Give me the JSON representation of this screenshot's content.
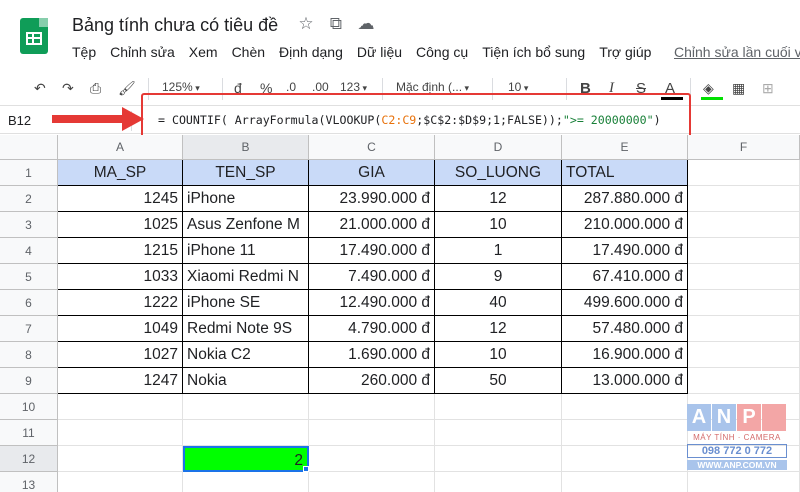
{
  "header": {
    "title": "Bảng tính chưa có tiêu đề",
    "star_icon": "star-icon",
    "move_icon": "folder-move-icon",
    "cloud_icon": "cloud-status-icon"
  },
  "menu": {
    "items": [
      "Tệp",
      "Chỉnh sửa",
      "Xem",
      "Chèn",
      "Định dạng",
      "Dữ liệu",
      "Công cụ",
      "Tiện ích bổ sung",
      "Trợ giúp"
    ],
    "last_edit": "Chỉnh sửa lần cuối v"
  },
  "toolbar": {
    "zoom": "125%",
    "currency": "đ",
    "percent": "%",
    "dec_less": ".0",
    "dec_more": ".00",
    "number_format": "123",
    "font": "Mặc định (...",
    "font_size": "10",
    "bold": "B",
    "italic": "I",
    "strike": "S",
    "text_color": "A",
    "colors": {
      "text_color_bar": "#000000",
      "fill_color_bar": "#00e000"
    }
  },
  "formula_bar": {
    "cell_ref": "B12",
    "formula_parts": [
      {
        "text": "= COUNTIF( ArrayFormula(VLOOKUP(",
        "color": "#202124"
      },
      {
        "text": "C2:C9",
        "color": "#e8710a"
      },
      {
        "text": ";$C$2:$D$9;1;FALSE));",
        "color": "#202124"
      },
      {
        "text": "\">= 20000000\"",
        "color": "#188038"
      },
      {
        "text": ")",
        "color": "#202124"
      }
    ]
  },
  "sheet": {
    "columns": [
      "A",
      "B",
      "C",
      "D",
      "E",
      "F"
    ],
    "rows": [
      "1",
      "2",
      "3",
      "4",
      "5",
      "6",
      "7",
      "8",
      "9",
      "10",
      "11",
      "12",
      "13"
    ],
    "headers": [
      "MA_SP",
      "TEN_SP",
      "GIA",
      "SO_LUONG",
      "TOTAL"
    ],
    "data": [
      [
        "1245",
        "iPhone",
        "23.990.000 đ",
        "12",
        "287.880.000 đ"
      ],
      [
        "1025",
        "Asus Zenfone M",
        "21.000.000 đ",
        "10",
        "210.000.000 đ"
      ],
      [
        "1215",
        "iPhone 11",
        "17.490.000 đ",
        "1",
        "17.490.000 đ"
      ],
      [
        "1033",
        "Xiaomi Redmi N",
        "7.490.000 đ",
        "9",
        "67.410.000 đ"
      ],
      [
        "1222",
        "iPhone SE",
        "12.490.000 đ",
        "40",
        "499.600.000 đ"
      ],
      [
        "1049",
        "Redmi Note 9S",
        "4.790.000 đ",
        "12",
        "57.480.000 đ"
      ],
      [
        "1027",
        "Nokia C2",
        "1.690.000 đ",
        "10",
        "16.900.000 đ"
      ],
      [
        "1247",
        "Nokia",
        "260.000 đ",
        "50",
        "13.000.000 đ"
      ]
    ],
    "selected_cell_value": "2",
    "header_fill": "#c9daf8",
    "selected_fill": "#00ff00"
  },
  "watermark": {
    "letters": [
      "A",
      "N",
      "P",
      ""
    ],
    "subtitle": "MÁY TÍNH · CAMERA",
    "phone": "098 772 0 772",
    "site": "WWW.ANP.COM.VN"
  }
}
